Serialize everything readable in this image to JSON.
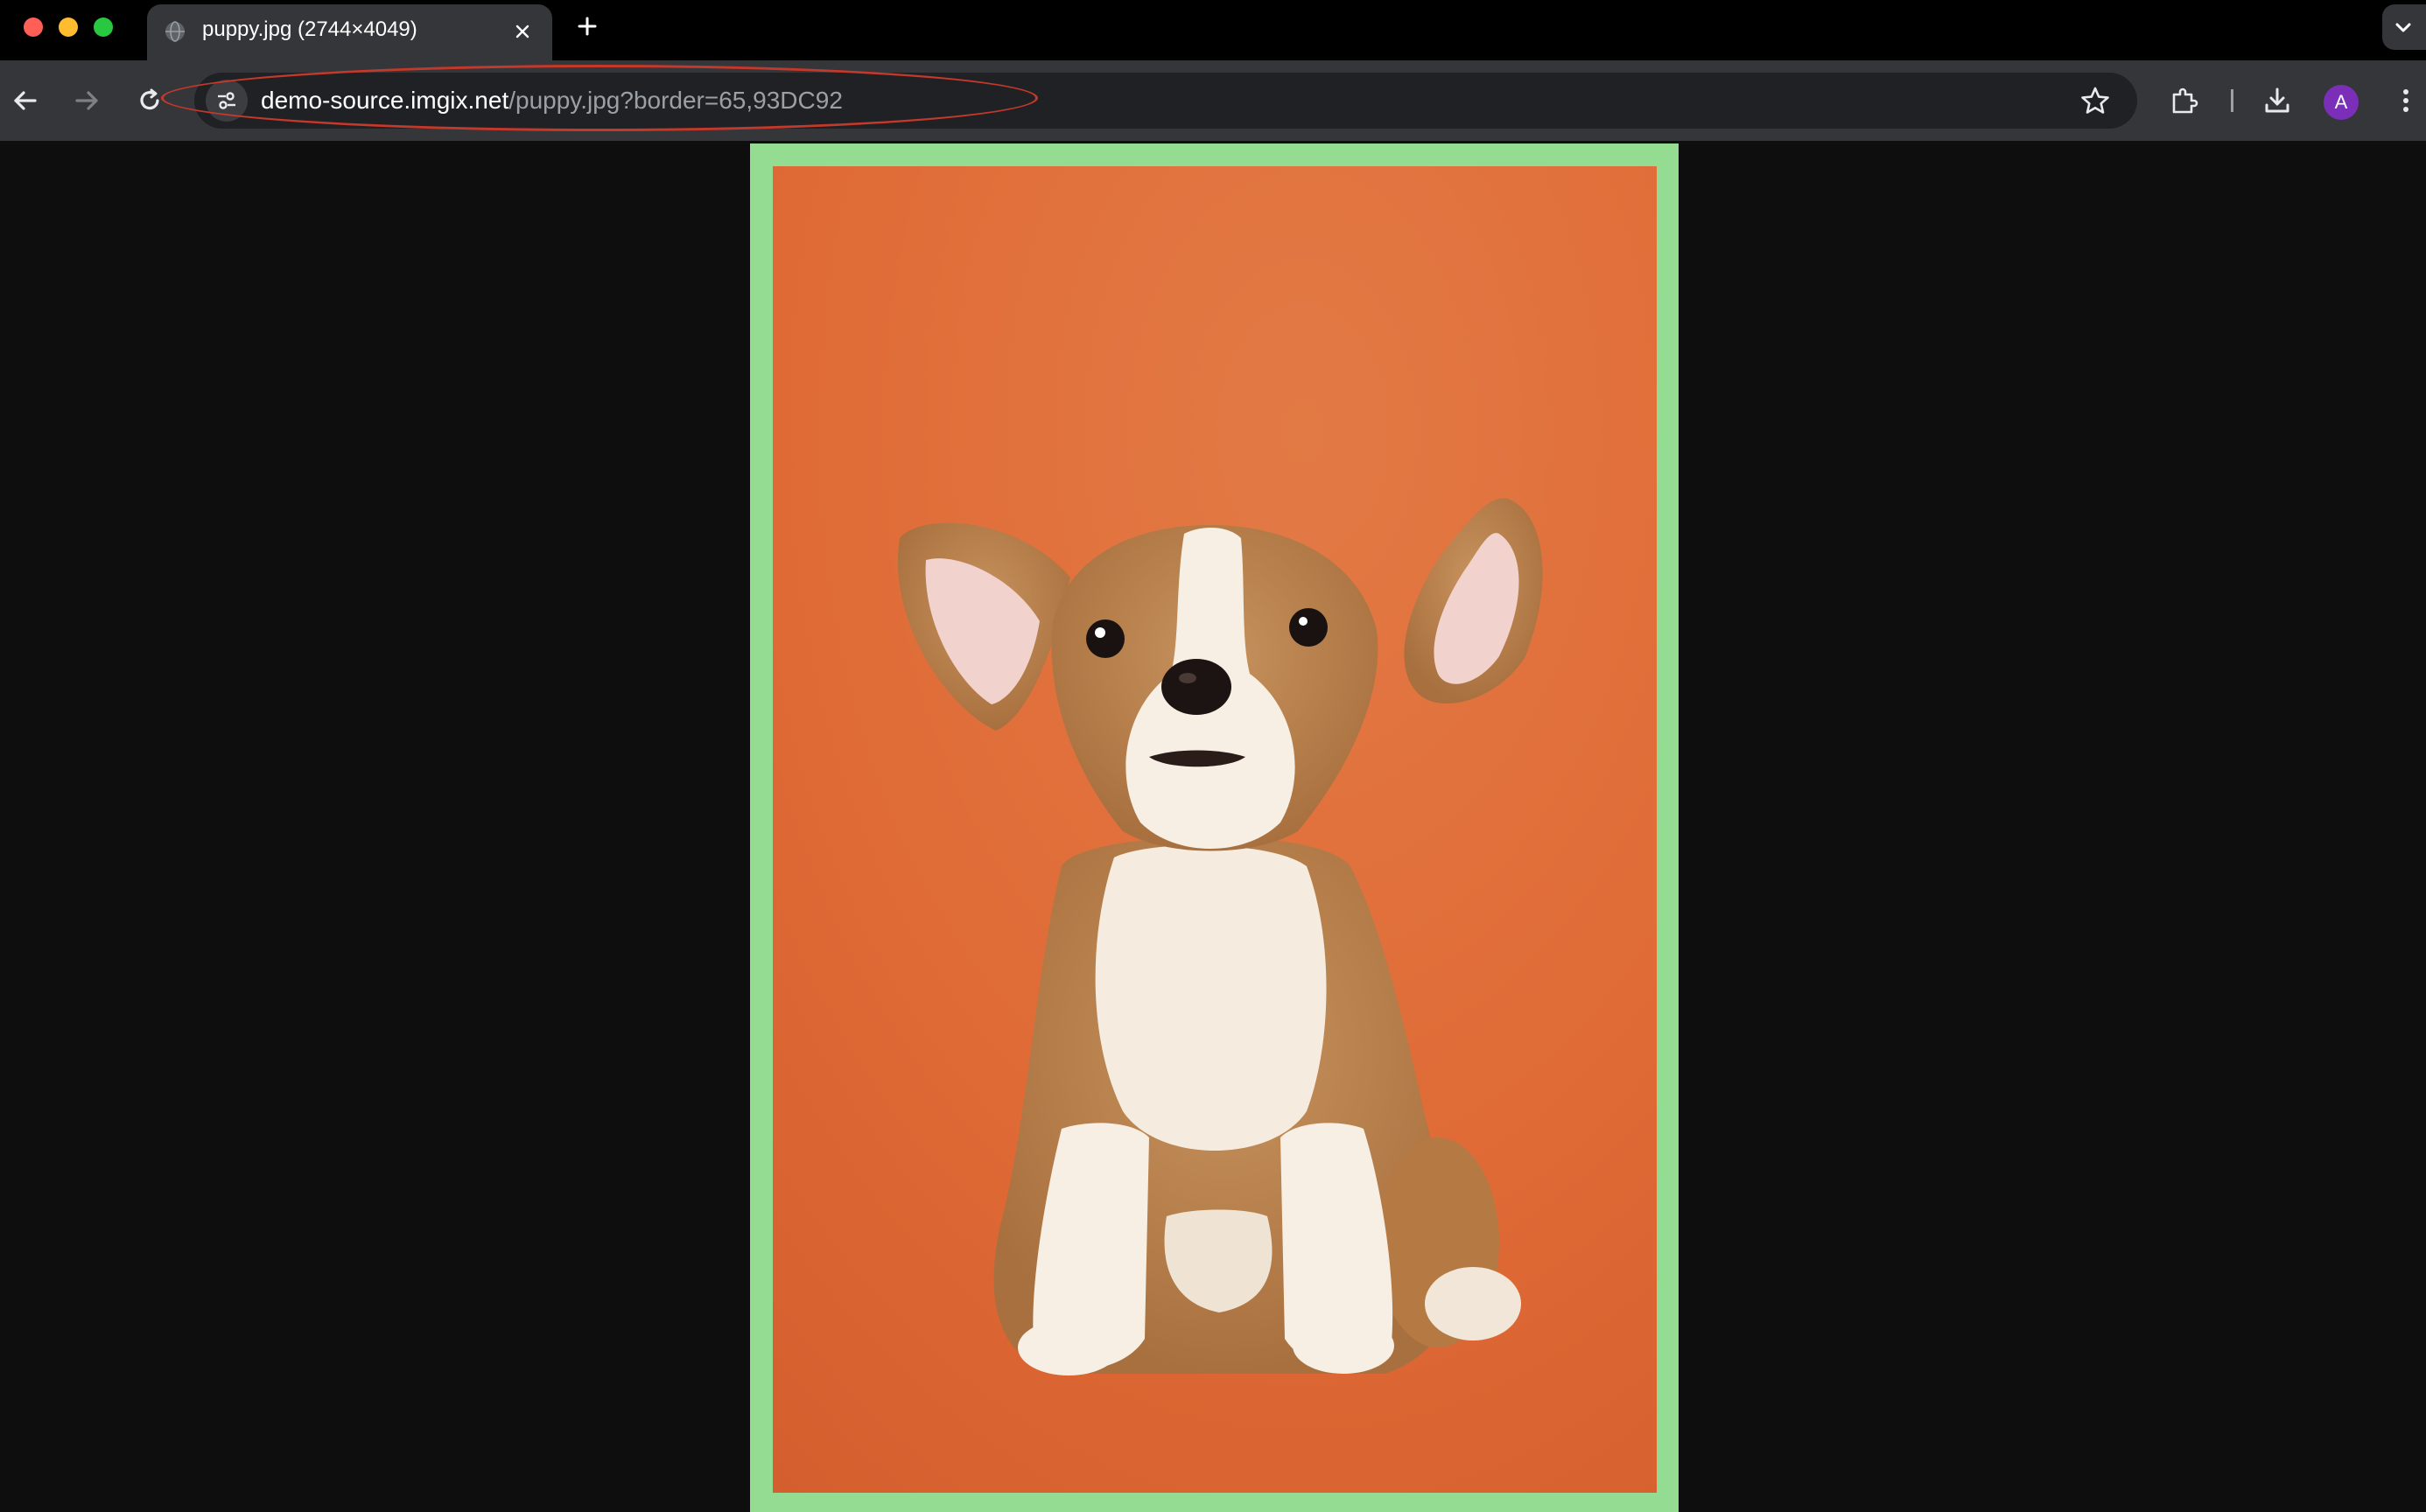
{
  "browser": {
    "tab": {
      "title": "puppy.jpg (2744×4049)",
      "favicon": "globe-icon"
    },
    "address_bar": {
      "host": "demo-source.imgix.net",
      "path": "/puppy.jpg?border=65,93DC92"
    },
    "profile": {
      "initial": "A",
      "color": "#7b2fb8"
    },
    "annotation_color": "#c4392b"
  },
  "image": {
    "border_color": "#93DC92",
    "background_color": "#e06c3a",
    "subject": "corgi puppy sitting on orange background"
  }
}
